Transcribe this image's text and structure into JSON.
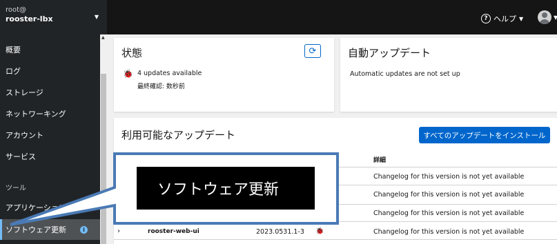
{
  "host": {
    "user": "root@",
    "name": "rooster-lbx"
  },
  "header": {
    "help_label": "ヘルプ"
  },
  "sidebar": {
    "items": [
      {
        "label": "概要"
      },
      {
        "label": "ログ"
      },
      {
        "label": "ストレージ"
      },
      {
        "label": "ネットワーキング"
      },
      {
        "label": "アカウント"
      },
      {
        "label": "サービス"
      },
      {
        "label": "ツール"
      },
      {
        "label": "アプリケーション"
      },
      {
        "label": "ソフトウェア更新",
        "badge": "i"
      }
    ]
  },
  "status_card": {
    "title": "状態",
    "updates_text": "4 updates available",
    "last_checked": "最終確認: 数秒前"
  },
  "auto_card": {
    "title": "自動アップデート",
    "message": "Automatic updates are not set up"
  },
  "updates_card": {
    "title": "利用可能なアップデート",
    "install_all_label": "すべてのアップデートをインストール",
    "details_header": "詳細",
    "rows": [
      {
        "details": "Changelog for this version is not yet available"
      },
      {
        "details": "Changelog for this version is not yet available"
      },
      {
        "details": "Changelog for this version is not yet available"
      },
      {
        "name": "rooster-web-ui",
        "version": "2023.0531.1-3",
        "details": "Changelog for this version is not yet available"
      }
    ]
  },
  "callout": {
    "text": "ソフトウェア更新"
  },
  "colors": {
    "accent": "#0066cc",
    "callout_border": "#4a7ab5",
    "sidebar_bg": "#212427"
  },
  "icons": [
    "help-icon",
    "user-avatar-icon",
    "refresh-icon",
    "bug-icon",
    "info-icon",
    "chevron-right-icon"
  ]
}
